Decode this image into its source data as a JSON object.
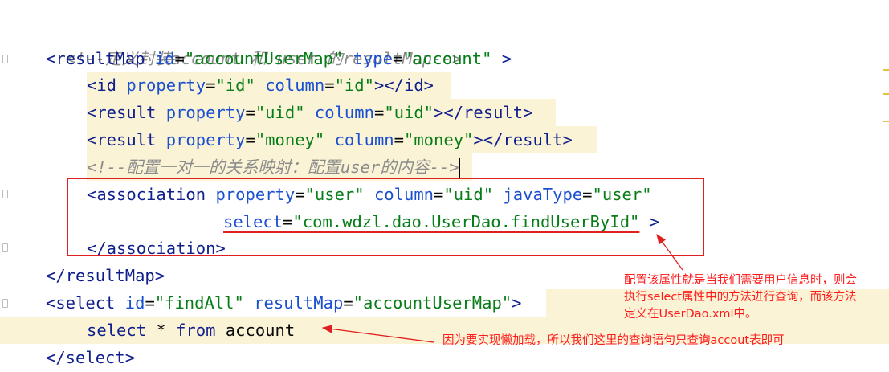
{
  "code": {
    "comment1": "<!--定义封装account 和 user 的resultMap-->",
    "resultmap_open": {
      "lt": "<",
      "tag": "resultMap",
      "a1": "id",
      "eq": "=",
      "v1": "\"accountUserMap\"",
      "a2": "type",
      "v2": "\"account\"",
      "close": " >"
    },
    "id_line": {
      "open": "<id ",
      "a1": "property",
      "v1": "\"id\"",
      "a2": "column",
      "v2": "\"id\"",
      "end": "></id>"
    },
    "result1": {
      "open": "<result ",
      "a1": "property",
      "v1": "\"uid\"",
      "a2": "column",
      "v2": "\"uid\"",
      "end": "></result>"
    },
    "result2": {
      "open": "<result ",
      "a1": "property",
      "v1": "\"money\"",
      "a2": "column",
      "v2": "\"money\"",
      "end": "></result>"
    },
    "comment2": "<!--配置一对一的关系映射：配置user的内容-->",
    "assoc": {
      "open": "<association ",
      "a1": "property",
      "v1": "\"user\"",
      "a2": "column",
      "v2": "\"uid\"",
      "a3": "javaType",
      "v3": "\"user\""
    },
    "select_attr": {
      "a": "select",
      "v": "\"com.wdzl.dao.UserDao.findUserById\"",
      "end": " >"
    },
    "assoc_close": "</association>",
    "resultmap_close": "</resultMap>",
    "select_open": {
      "open": "<select ",
      "a1": "id",
      "v1": "\"findAll\"",
      "a2": "resultMap",
      "v2": "\"accountUserMap\"",
      "end": ">"
    },
    "sql": {
      "kw1": "select",
      "star": " * ",
      "kw2": "from",
      "table": " account"
    },
    "select_close": "</select>"
  },
  "annotations": {
    "note1_l1": "配置该属性就是当我们需要用户信息时，则会",
    "note1_l2": "执行select属性中的方法进行查询，而该方法",
    "note1_l3": "定义在UserDao.xml中。",
    "note2": "因为要实现懒加载，所以我们这里的查询语句只查询accout表即可"
  },
  "colors": {
    "annotation": "#e02020",
    "highlight": "#fbf3d6",
    "tag": "#0f1f8c",
    "string": "#067d17",
    "comment": "#8c8c8c"
  }
}
